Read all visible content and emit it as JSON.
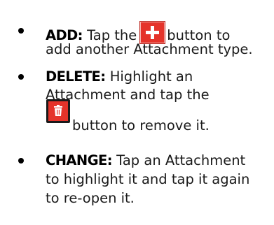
{
  "items": [
    {
      "keyword": "ADD:",
      "line1_before": "Tap the",
      "line1_after": "button to",
      "line2": "add another Attachment type.",
      "icon": "add-plus-icon"
    },
    {
      "keyword": "DELETE:",
      "line1": "Highlight an",
      "line2": "Attachment and tap the",
      "line3": "button to remove it.",
      "icon": "trash-icon"
    },
    {
      "keyword": "CHANGE:",
      "line1": "Tap an Attachment",
      "line2": "to highlight it and tap it again",
      "line3": "to re-open it."
    }
  ],
  "colors": {
    "icon_red": "#e5332a",
    "text": "#1a1a1a"
  }
}
